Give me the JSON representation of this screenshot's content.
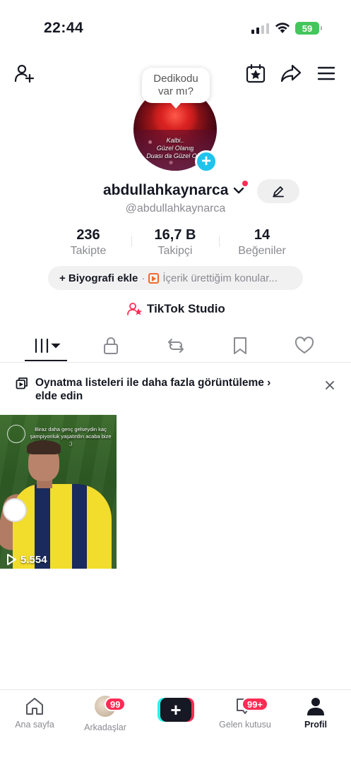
{
  "status_bar": {
    "time": "22:44",
    "battery": "59"
  },
  "top_nav": {
    "icons": [
      "add-friend-icon",
      "calendar-star-icon",
      "share-icon",
      "menu-icon"
    ]
  },
  "profile": {
    "bubble_line1": "Dedikodu",
    "bubble_line2": "var mı?",
    "avatar_text_line1": "Kalbi..",
    "avatar_text_line2": "Güzel Olanın",
    "avatar_text_line3": "Duası da Güzel  Olur",
    "username": "abdullahkaynarca",
    "handle": "@abdullahkaynarca",
    "stats": [
      {
        "value": "236",
        "label": "Takipte"
      },
      {
        "value": "16,7 B",
        "label": "Takipçi"
      },
      {
        "value": "14",
        "label": "Beğeniler"
      }
    ],
    "bio_add": "+ Biyografi ekle",
    "bio_separator": "·",
    "bio_topics": "İçerik ürettiğim konular...",
    "studio_label": "TikTok Studio"
  },
  "tabs": [
    "videos-grid-tab",
    "private-tab",
    "reposts-tab",
    "saved-tab",
    "liked-tab"
  ],
  "promo": {
    "text": "Oynatma listeleri ile daha fazla görüntüleme  ›  elde edin"
  },
  "videos": [
    {
      "caption": "Biraz daha genç gelseydin kaç şampiyonluk yaşatırdın acaba bize ;)",
      "views": "5.554"
    }
  ],
  "bottom_nav": {
    "items": [
      {
        "label": "Ana sayfa"
      },
      {
        "label": "Arkadaşlar",
        "badge": "99"
      },
      {
        "label": ""
      },
      {
        "label": "Gelen kutusu",
        "badge": "99+"
      },
      {
        "label": "Profil"
      }
    ]
  },
  "colors": {
    "accent_red": "#fe2c55",
    "accent_cyan": "#25f4ee",
    "avatar_add_blue": "#20c3ee",
    "battery_green": "#43c65b"
  }
}
